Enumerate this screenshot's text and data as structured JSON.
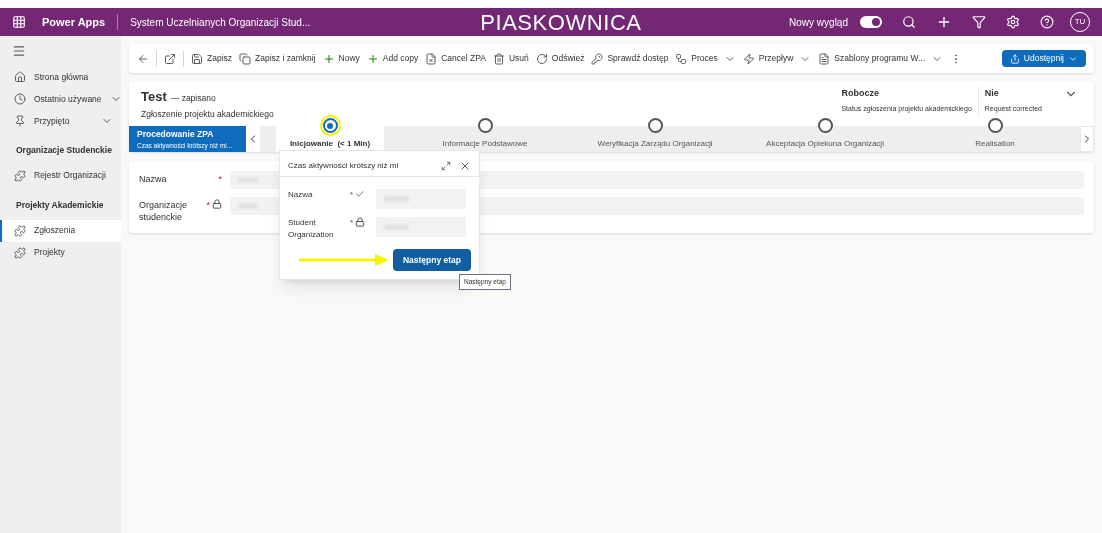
{
  "top_bar": {
    "app_name": "Power Apps",
    "environment": "System Uczelnianych Organizacji Stud...",
    "banner": "PIASKOWNICA",
    "new_look": {
      "label": "Nowy wygląd",
      "on": true
    },
    "avatar": "TU"
  },
  "sidebar": {
    "items": [
      {
        "kind": "nav",
        "label": "Strona główna",
        "selected": false
      },
      {
        "kind": "expander",
        "label": "Ostatnio używane",
        "selected": false
      },
      {
        "kind": "expander",
        "label": "Przypięto",
        "selected": false
      },
      {
        "kind": "section",
        "label": "Organizacje Studenckie"
      },
      {
        "kind": "nav",
        "label": "Rejestr Organizacji",
        "selected": false
      },
      {
        "kind": "section",
        "label": "Projekty Akademickie"
      },
      {
        "kind": "nav",
        "label": "Zgłoszenia",
        "selected": true
      },
      {
        "kind": "nav",
        "label": "Projekty",
        "selected": false
      }
    ]
  },
  "toolbar": {
    "items": [
      {
        "label": "Zapisz",
        "caret": false
      },
      {
        "label": "Zapisz i zamknij",
        "caret": false
      },
      {
        "label": "Nowy",
        "caret": false
      },
      {
        "label": "Add copy",
        "caret": false
      },
      {
        "label": "Cancel ZPA",
        "caret": false
      },
      {
        "label": "Usuń",
        "caret": false
      },
      {
        "label": "Odśwież",
        "caret": false
      },
      {
        "label": "Sprawdź dostęp",
        "caret": false
      },
      {
        "label": "Proces",
        "caret": true
      },
      {
        "label": "Przepływ",
        "caret": true
      },
      {
        "label": "Szablony programu W...",
        "caret": true
      }
    ],
    "share": "Udostępnij"
  },
  "header": {
    "title": "Test",
    "saved": "— zapisano",
    "entity": "Zgłoszenie projektu akademickiego",
    "fields": [
      {
        "value": "Robocze",
        "label": "Status zgłoszenia projektu akademickiego"
      },
      {
        "value": "Nie",
        "label": "Request corrected"
      }
    ]
  },
  "process": {
    "active": {
      "name": "Procedowanie ZPA",
      "subtitle": "Czas aktywności krótszy niż mi..."
    },
    "stages": [
      {
        "name": "Inicjowanie",
        "duration": "(< 1 Min)",
        "selected": true
      },
      {
        "name": "Informacje Podstawowe",
        "selected": false
      },
      {
        "name": "Weryfikacja Zarządu Organizacji",
        "selected": false
      },
      {
        "name": "Akceptacja Opiekuna Organizacji",
        "selected": false
      },
      {
        "name": "Realisation",
        "selected": false
      }
    ]
  },
  "form": {
    "fields": [
      {
        "label": "Nazwa",
        "required": true,
        "required_mark": "*",
        "locked": false
      },
      {
        "label": "Organizacje studenckie",
        "required": true,
        "required_mark": "*",
        "locked": true
      }
    ]
  },
  "flyout": {
    "title": "Czas aktywności krótszy niż mi",
    "fields": [
      {
        "label": "Nazwa",
        "required": true,
        "required_mark": "*",
        "validated": true,
        "locked": false
      },
      {
        "label": "Student Organization",
        "required": true,
        "required_mark": "*",
        "validated": false,
        "locked": true
      }
    ],
    "button": "Następny etap",
    "tooltip": "Następny etap"
  }
}
